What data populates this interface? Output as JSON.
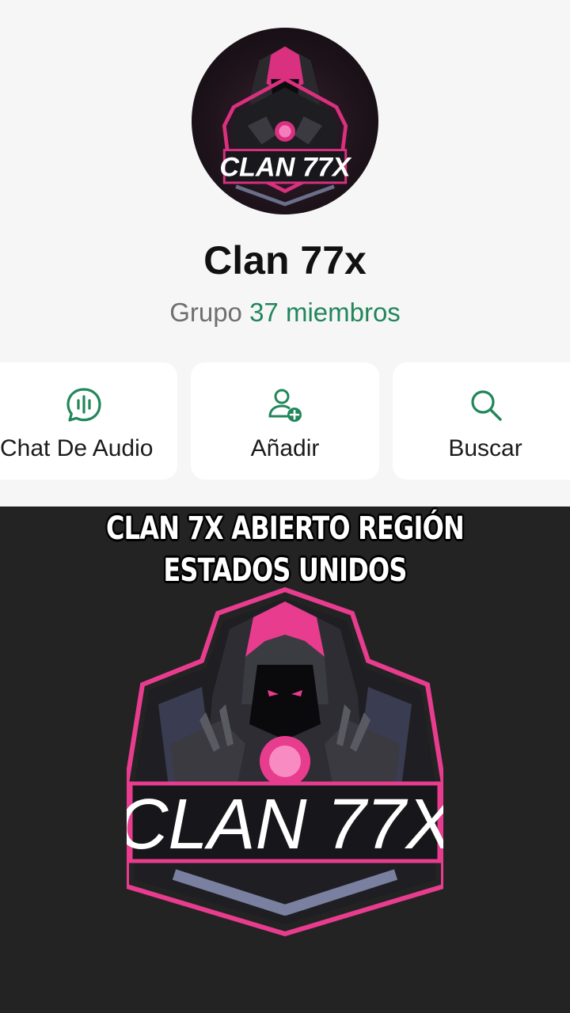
{
  "group": {
    "name": "Clan 77x",
    "type_label": "Grupo",
    "members_label": "37 miembros"
  },
  "actions": [
    {
      "label": "Chat De Audio",
      "icon": "audio-chat-icon"
    },
    {
      "label": "Añadir",
      "icon": "add-person-icon"
    },
    {
      "label": "Buscar",
      "icon": "search-icon"
    }
  ],
  "overlay": {
    "line1": "Clan 7X abierto región",
    "line2": "Estados Unidos"
  },
  "logo": {
    "text": "CLAN 77X"
  },
  "colors": {
    "accent_green": "#21875a",
    "logo_pink": "#e83c8e",
    "dark_bg": "#232323"
  }
}
